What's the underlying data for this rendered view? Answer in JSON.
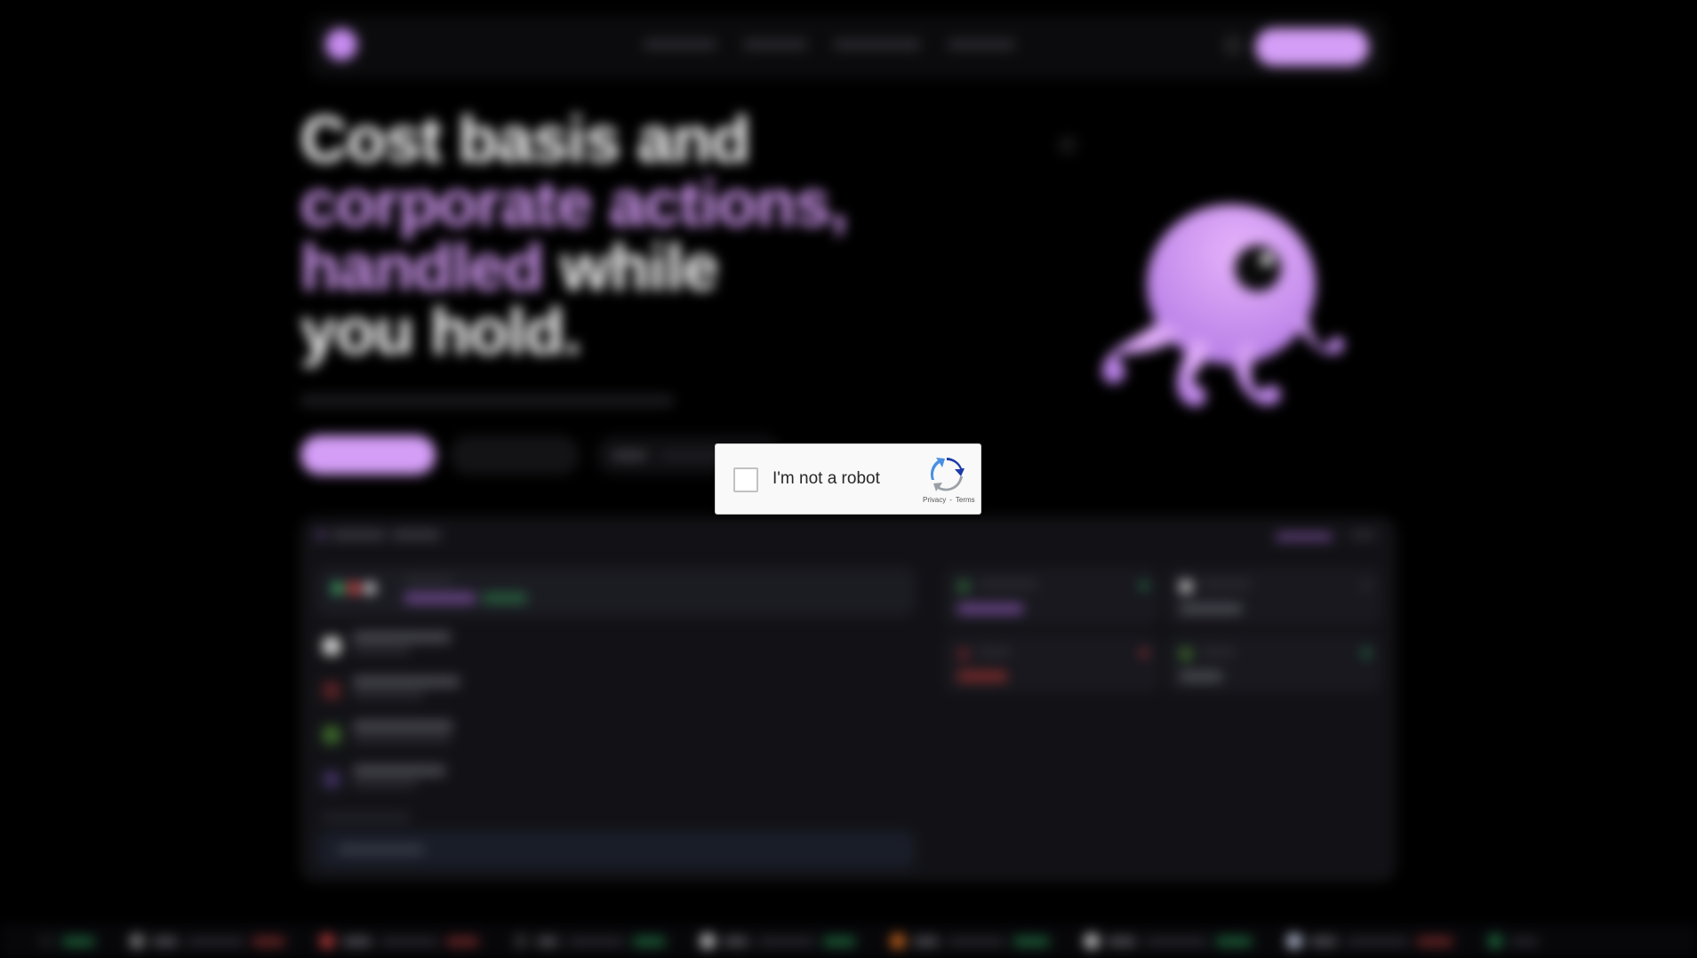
{
  "captcha": {
    "label": "I'm not a robot",
    "privacy": "Privacy",
    "separator": "-",
    "terms": "Terms"
  },
  "colors": {
    "accent": "#d49ef7",
    "background": "#000000",
    "positive": "#2fa860",
    "negative": "#c43d3d"
  },
  "hero": {
    "line1": "Cost basis and",
    "line2": "corporate actions,",
    "line3_highlight": "handled",
    "line3_rest": "while",
    "line4": "you hold."
  }
}
